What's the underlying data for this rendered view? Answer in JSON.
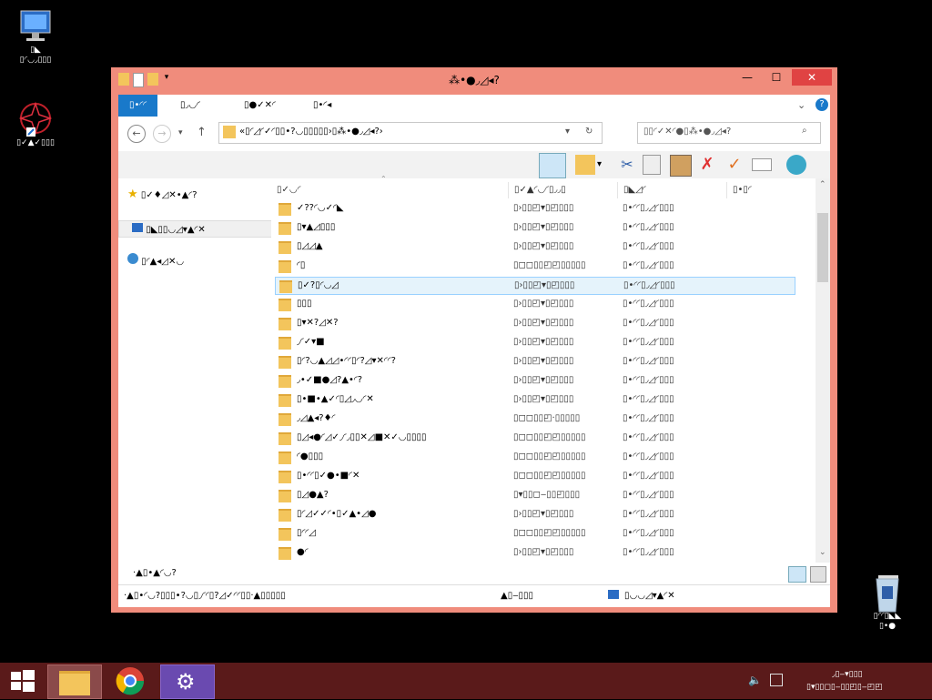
{
  "desktop": {
    "icons": [
      {
        "label_line1": "▯◣",
        "label_line2": "▯◜◡◞▯▯▯"
      },
      {
        "label_line1": "▯✓▲✓▯▯▯",
        "label_line2": ""
      },
      {
        "label_line1": "▯◜◜▯◣◣",
        "label_line2": "▯•●"
      }
    ]
  },
  "window": {
    "title": "⁂•●◞◿◂?",
    "minimize": "—",
    "maximize": "☐",
    "close": "✕",
    "tabs": [
      "▯•◜◜",
      "▯◞◡◜",
      "▯●✓✕◜",
      "▯•◜◂"
    ],
    "address": "«▯◜◿◜✓◜▯▯•?◡▯▯▯▯▯›▯⁂•●◞◿◂?›",
    "search_placeholder": "▯▯◜✓✕◜●▯⁂•●◞◿◂?"
  },
  "navpane": {
    "items": [
      "▯✓♦◿✕•▲◜?",
      "▯◣▯▯◡◿▾▲◜✕",
      "▯◜▲◂◿✕◡"
    ]
  },
  "filepane": {
    "columns": [
      "▯✓◡◜",
      "▯✓▲◜◡◜▯◞◞▯",
      "▯◣◿◜",
      "▯•▯◜"
    ],
    "rows": [
      {
        "name": "✓??◜◡✓◜◣",
        "date": "▯›▯▯◰▾▯◰▯▯▯",
        "type": "▯•◜◜▯◞◿◜▯▯▯"
      },
      {
        "name": "▯▾▲◿▯▯▯",
        "date": "▯›▯▯◰▾▯◰▯▯▯",
        "type": "▯•◜◜▯◞◿◜▯▯▯"
      },
      {
        "name": "▯◿◿▲",
        "date": "▯›▯▯◰▾▯◰▯▯▯",
        "type": "▯•◜◜▯◞◿◜▯▯▯"
      },
      {
        "name": "◜▯",
        "date": "▯◻◻▯▯◰◰▯▯▯▯▯",
        "type": "▯•◜◜▯◞◿◜▯▯▯"
      },
      {
        "name": "▯✓?▯◜◡◿",
        "date": "▯›▯▯◰▾▯◰▯▯▯",
        "type": "▯•◜◜▯◞◿◜▯▯▯"
      },
      {
        "name": "▯▯▯",
        "date": "▯›▯▯◰▾▯◰▯▯▯",
        "type": "▯•◜◜▯◞◿◜▯▯▯"
      },
      {
        "name": "▯▾✕?◿✕?",
        "date": "▯›▯▯◰▾▯◰▯▯▯",
        "type": "▯•◜◜▯◞◿◜▯▯▯"
      },
      {
        "name": "◞◜✓▾■",
        "date": "▯›▯▯◰▾▯◰▯▯▯",
        "type": "▯•◜◜▯◞◿◜▯▯▯"
      },
      {
        "name": "▯◜?◡▲◿◿•◜◜▯◜?◿▾✕◜◜?",
        "date": "▯›▯▯◰▾▯◰▯▯▯",
        "type": "▯•◜◜▯◞◿◜▯▯▯"
      },
      {
        "name": "◞•✓■●◿?▲•◜?",
        "date": "▯›▯▯◰▾▯◰▯▯▯",
        "type": "▯•◜◜▯◞◿◜▯▯▯"
      },
      {
        "name": "▯•■•▲✓◜▯◿◞◡◜✕",
        "date": "▯›▯▯◰▾▯◰▯▯▯",
        "type": "▯•◜◜▯◞◿◜▯▯▯"
      },
      {
        "name": "◞◿▲◂?♦◜",
        "date": "▯◻◻▯▯◰·▯▯▯▯▯",
        "type": "▯•◜◜▯◞◿◜▯▯▯"
      },
      {
        "name": "▯◿◂●◜◿✓◞◜◞▯▯✕◿■✕✓◡▯▯▯▯",
        "date": "▯◻◻▯▯◰◰▯▯▯▯▯",
        "type": "▯•◜◜▯◞◿◜▯▯▯"
      },
      {
        "name": "◜●▯▯▯",
        "date": "▯◻◻▯▯◰◰▯▯▯▯▯",
        "type": "▯•◜◜▯◞◿◜▯▯▯"
      },
      {
        "name": "▯•◜◜▯✓●•■◜✕",
        "date": "▯◻◻▯▯◰◰▯▯▯▯▯",
        "type": "▯•◜◜▯◞◿◜▯▯▯"
      },
      {
        "name": "▯◿●▲?",
        "date": "▯▾▯▯◻‒▯▯◰▯▯▯",
        "type": "▯•◜◜▯◞◿◜▯▯▯"
      },
      {
        "name": "▯◜◿✓✓◜•▯✓▲•◿●",
        "date": "▯›▯▯◰▾▯◰▯▯▯",
        "type": "▯•◜◜▯◞◿◜▯▯▯"
      },
      {
        "name": "▯◜◜◿",
        "date": "▯◻◻▯▯◰◰▯▯▯▯▯",
        "type": "▯•◜◜▯◞◿◜▯▯▯"
      },
      {
        "name": "●◜",
        "date": "▯›▯▯◰▾▯◰▯▯▯",
        "type": "▯•◜◜▯◞◿◜▯▯▯"
      }
    ],
    "selected_index": 4
  },
  "status": {
    "item_count": "·▲▯•▲◜◡?",
    "details_left": "·▲▯•◜◡?▯▯▯•?◡▯◞◜◜▯?◿✓◜◜▯▯·▲▯▯▯▯▯",
    "details_mid": "▲▯‒▯▯▯",
    "details_right": "▯◡◡◿▾▲◜✕"
  },
  "taskbar": {
    "tray_line1": "◞▯‒▾▯▯▯",
    "tray_line2": "▯▾▯▯◻▯‒▯▯◰▯‒◰◰"
  },
  "colors": {
    "window_frame": "#f08c7c",
    "active_tab": "#1979ca",
    "selection": "#e5f3fb",
    "taskbar": "#5a1a1a"
  }
}
